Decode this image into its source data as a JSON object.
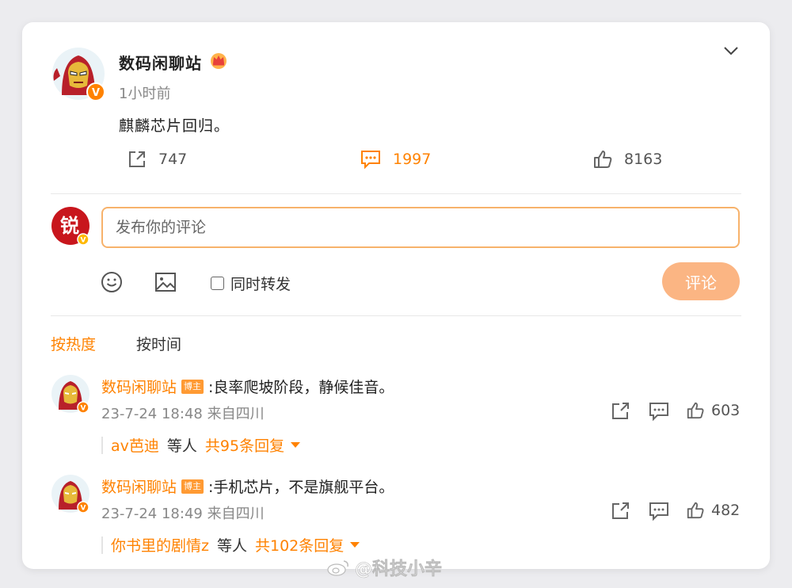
{
  "post": {
    "author": "数码闲聊站",
    "time": "1小时前",
    "text": "麒麟芯片回归。",
    "stats": {
      "reposts": "747",
      "comments": "1997",
      "likes": "8163"
    }
  },
  "composer": {
    "placeholder": "发布你的评论",
    "repost_label": "同时转发",
    "submit_label": "评论",
    "avatar_char": "锐"
  },
  "tabs": [
    {
      "label": "按热度",
      "active": true
    },
    {
      "label": "按时间",
      "active": false
    }
  ],
  "comments": [
    {
      "author": "数码闲聊站",
      "badge": "博主",
      "text": ":良率爬坡阶段，静候佳音。",
      "meta": "23-7-24 18:48 来自四川",
      "likes": "603",
      "reply_user": "av芭迪",
      "reply_etc": "等人",
      "reply_count": "共95条回复"
    },
    {
      "author": "数码闲聊站",
      "badge": "博主",
      "text": ":手机芯片，不是旗舰平台。",
      "meta": "23-7-24 18:49 来自四川",
      "likes": "482",
      "reply_user": "你书里的剧情z",
      "reply_etc": "等人",
      "reply_count": "共102条回复"
    }
  ],
  "watermark": "@科技小辛",
  "colors": {
    "accent": "#ff8200",
    "submit": "#fbb583",
    "input_border": "#f7b26b"
  }
}
